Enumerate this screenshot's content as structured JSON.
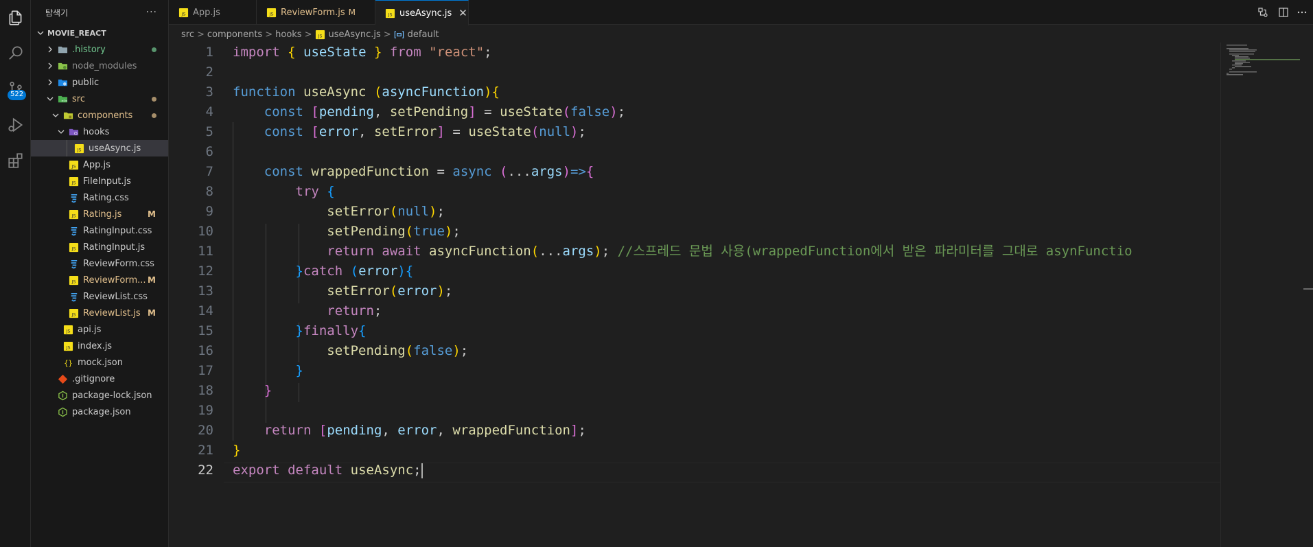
{
  "sidebar": {
    "title": "탐색기",
    "more_label": "···",
    "root_label": "MOVIE_REACT",
    "source_control_badge": "522",
    "items": [
      {
        "label": ".history",
        "color": "#73c991"
      },
      {
        "label": "node_modules",
        "color": "#8c8c8c"
      },
      {
        "label": "public",
        "color": "#cccccc"
      },
      {
        "label": "src",
        "color": "#e2c08d"
      },
      {
        "label": "components",
        "color": "#e2c08d"
      },
      {
        "label": "hooks",
        "color": "#cccccc"
      },
      {
        "label": "useAsync.js",
        "color": "#cccccc"
      },
      {
        "label": "App.js",
        "color": "#cccccc"
      },
      {
        "label": "FileInput.js",
        "color": "#cccccc"
      },
      {
        "label": "Rating.css",
        "color": "#cccccc"
      },
      {
        "label": "Rating.js",
        "color": "#e2c08d",
        "status": "M"
      },
      {
        "label": "RatingInput.css",
        "color": "#cccccc"
      },
      {
        "label": "RatingInput.js",
        "color": "#cccccc"
      },
      {
        "label": "ReviewForm.css",
        "color": "#cccccc"
      },
      {
        "label": "ReviewForm...",
        "color": "#e2c08d",
        "status": "M"
      },
      {
        "label": "ReviewList.css",
        "color": "#cccccc"
      },
      {
        "label": "ReviewList.js",
        "color": "#e2c08d",
        "status": "M"
      },
      {
        "label": "api.js",
        "color": "#cccccc"
      },
      {
        "label": "index.js",
        "color": "#cccccc"
      },
      {
        "label": "mock.json",
        "color": "#cccccc"
      },
      {
        "label": ".gitignore",
        "color": "#cccccc"
      },
      {
        "label": "package-lock.json",
        "color": "#cccccc"
      },
      {
        "label": "package.json",
        "color": "#cccccc"
      }
    ]
  },
  "tabs": [
    {
      "label": "App.js",
      "status": ""
    },
    {
      "label": "ReviewForm.js",
      "status": "M"
    },
    {
      "label": "useAsync.js",
      "status": "",
      "close": "✕"
    }
  ],
  "breadcrumb": {
    "parts": [
      "src",
      "components",
      "hooks",
      "useAsync.js",
      "default"
    ],
    "separator": ">"
  },
  "editor": {
    "current_line": 22,
    "line_numbers": [
      "1",
      "2",
      "3",
      "4",
      "5",
      "6",
      "7",
      "8",
      "9",
      "10",
      "11",
      "12",
      "13",
      "14",
      "15",
      "16",
      "17",
      "18",
      "19",
      "20",
      "21",
      "22"
    ],
    "comment_text": "//스프레드 문법 사용(wrappedFunction에서 받은 파라미터를 그대로 asynFunctio"
  },
  "colors": {
    "accent": "#0078d4",
    "modified": "#e2c08d",
    "untracked": "#73c991"
  }
}
